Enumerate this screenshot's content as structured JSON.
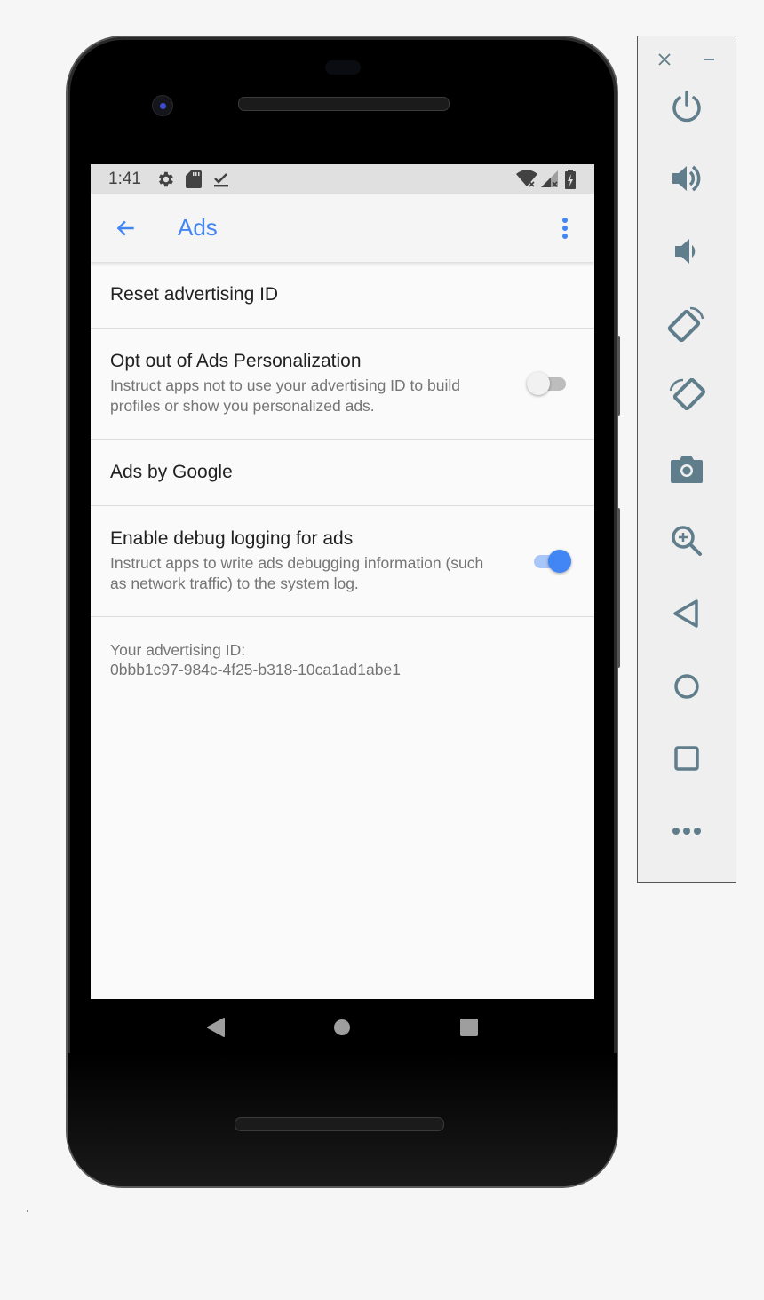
{
  "statusbar": {
    "time": "1:41",
    "left_icons": [
      "gear-icon",
      "sd-card-icon",
      "download-done-icon"
    ],
    "right_icons": [
      "wifi-off-icon",
      "signal-off-icon",
      "battery-charging-icon"
    ]
  },
  "appbar": {
    "title": "Ads",
    "back_icon": "arrow-back-icon",
    "menu_icon": "more-vert-icon"
  },
  "preferences": [
    {
      "title": "Reset advertising ID"
    },
    {
      "title": "Opt out of Ads Personalization",
      "summary": "Instruct apps not to use your advertising ID to build profiles or show you personalized ads.",
      "switch_on": false
    },
    {
      "title": "Ads by Google"
    },
    {
      "title": "Enable debug logging for ads",
      "summary": "Instruct apps to write ads debugging information (such as network traffic) to the system log.",
      "switch_on": true
    }
  ],
  "advertising_id": {
    "label": "Your advertising ID:",
    "value": "0bbb1c97-984c-4f25-b318-10ca1ad1abe1"
  },
  "navbar": [
    "back-icon",
    "home-icon",
    "overview-icon"
  ],
  "emulator_toolbar": {
    "window_controls": [
      "close-icon",
      "minimize-icon"
    ],
    "buttons": [
      "power",
      "volume-up",
      "volume-down",
      "rotate-left",
      "rotate-right",
      "screenshot",
      "zoom",
      "back",
      "home",
      "overview",
      "more"
    ]
  },
  "colors": {
    "accent": "#4285f4",
    "toolbar_icon": "#607d8b"
  }
}
